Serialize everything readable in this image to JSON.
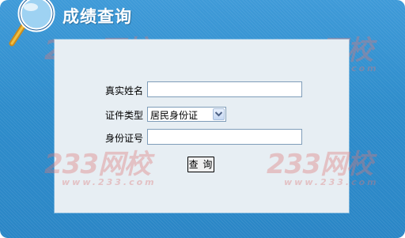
{
  "header": {
    "title": "成绩查询",
    "icon": "magnifier-icon"
  },
  "watermark": {
    "brand": "233网校",
    "url": "www.233.com"
  },
  "form": {
    "name_label": "真实姓名",
    "name_value": "",
    "id_type_label": "证件类型",
    "id_type_selected": "居民身份证",
    "id_number_label": "身份证号",
    "id_number_value": "",
    "submit_label": "查 询"
  },
  "colors": {
    "frame": "#2f8fcf",
    "panel": "#e7eef3",
    "watermark": "#de7878"
  }
}
